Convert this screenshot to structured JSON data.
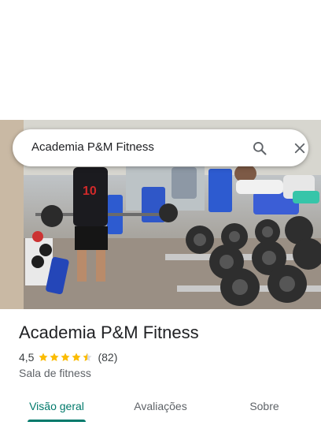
{
  "search": {
    "query": "Academia P&M Fitness"
  },
  "place": {
    "title": "Academia P&M Fitness",
    "rating": "4,5",
    "rating_value": 4.5,
    "reviews": "(82)",
    "category": "Sala de fitness"
  },
  "tabs": [
    {
      "label": "Visão geral",
      "active": true
    },
    {
      "label": "Avaliações",
      "active": false
    },
    {
      "label": "Sobre",
      "active": false
    }
  ],
  "colors": {
    "accent": "#00796b",
    "star": "#fbbc04",
    "star_empty": "#dadce0"
  },
  "icons": {
    "search": "search-icon",
    "close": "close-icon",
    "star": "star-icon"
  }
}
